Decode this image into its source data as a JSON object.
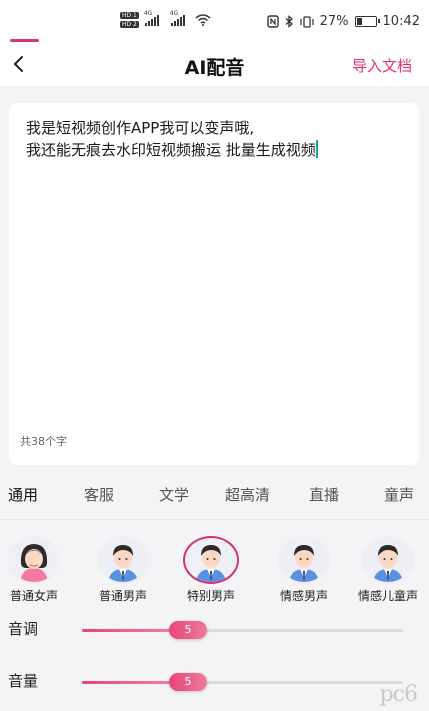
{
  "status_bar": {
    "hd1": "HD 1",
    "hd2": "HD 2",
    "net1": "4G",
    "net2": "4G",
    "battery_percent": "27%",
    "battery_level": 0.27,
    "time": "10:42"
  },
  "header": {
    "title": "AI配音",
    "import_label": "导入文档",
    "accent_color": "#e0336b"
  },
  "editor": {
    "text": "我是短视频创作APP我可以变声哦,\n我还能无痕去水印短视频搬运 批量生成视频",
    "char_count": "共38个字"
  },
  "tabs": [
    {
      "label": "通用",
      "active": true
    },
    {
      "label": "客服",
      "active": false
    },
    {
      "label": "文学",
      "active": false
    },
    {
      "label": "超高清",
      "active": false
    },
    {
      "label": "直播",
      "active": false
    },
    {
      "label": "童声",
      "active": false
    }
  ],
  "voices": [
    {
      "label": "普通女声",
      "avatar": "female-avatar",
      "selected": false
    },
    {
      "label": "普通男声",
      "avatar": "male-avatar",
      "selected": false
    },
    {
      "label": "特别男声",
      "avatar": "male-avatar",
      "selected": true
    },
    {
      "label": "情感男声",
      "avatar": "male-avatar",
      "selected": false
    },
    {
      "label": "情感儿童声",
      "avatar": "male-avatar",
      "selected": false
    }
  ],
  "sliders": {
    "pitch": {
      "label": "音调",
      "value": "5",
      "level": 0.33
    },
    "volume": {
      "label": "音量",
      "value": "5",
      "level": 0.33
    }
  },
  "watermark": "pc6"
}
